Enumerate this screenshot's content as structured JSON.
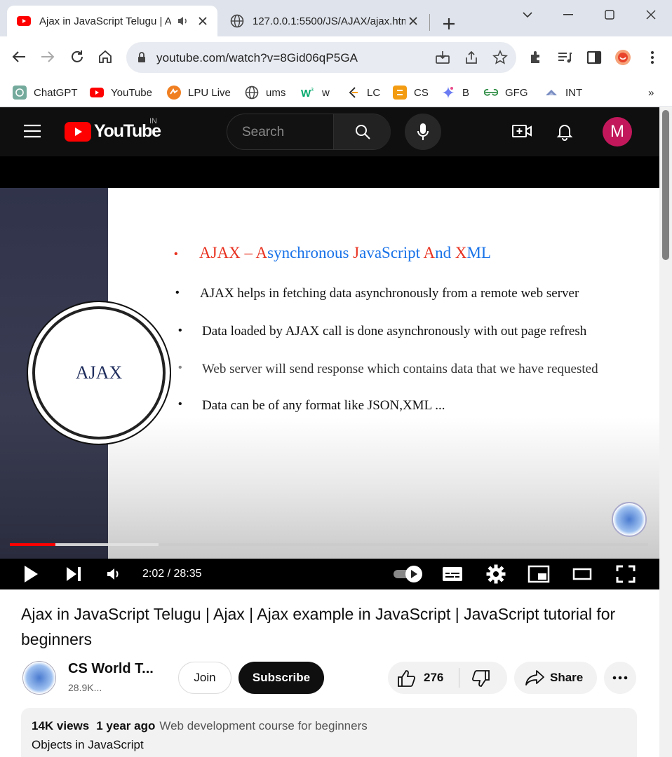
{
  "browser": {
    "tabs": [
      {
        "title": "Ajax in JavaScript Telugu | A",
        "active": true,
        "favicon": "youtube-icon",
        "audio": true
      },
      {
        "title": "127.0.0.1:5500/JS/AJAX/ajax.htm",
        "active": false,
        "favicon": "globe-icon"
      }
    ],
    "url": "youtube.com/watch?v=8Gid06qP5GA",
    "bookmarks": [
      {
        "label": "ChatGPT",
        "icon": "chatgpt-icon"
      },
      {
        "label": "YouTube",
        "icon": "youtube-icon"
      },
      {
        "label": "LPU Live",
        "icon": "lpu-icon"
      },
      {
        "label": "ums",
        "icon": "globe-icon"
      },
      {
        "label": "w",
        "icon": "w3schools-icon"
      },
      {
        "label": "LC",
        "icon": "leetcode-icon"
      },
      {
        "label": "CS",
        "icon": "codestudio-icon"
      },
      {
        "label": "B",
        "icon": "gemini-icon"
      },
      {
        "label": "GFG",
        "icon": "gfg-icon"
      },
      {
        "label": "INT",
        "icon": "int-icon"
      }
    ],
    "more_bookmarks": "»"
  },
  "youtube": {
    "logo_text": "YouTube",
    "region": "IN",
    "search_placeholder": "Search",
    "avatar_letter": "M",
    "accent": "#ff0000"
  },
  "slide": {
    "circle_label": "AJAX",
    "heading": {
      "a": "AJAX – ",
      "b": "A",
      "c": "synchronous ",
      "d": "J",
      "e": "avaScript ",
      "f": "A",
      "g": "nd ",
      "h": "X",
      "i": "ML"
    },
    "points": [
      "AJAX helps in fetching data asynchronously from a remote web server",
      "Data loaded by AJAX call is done asynchronously with out page refresh",
      "Web server will send response which contains data that we  have requested",
      "Data can be of any format like JSON,XML ..."
    ]
  },
  "player": {
    "time": "2:02 / 28:35",
    "progress_fraction": 0.0712,
    "buffered_fraction": 0.233
  },
  "video": {
    "title": "Ajax in JavaScript Telugu | Ajax | Ajax example in JavaScript | JavaScript tutorial for beginners",
    "channel": "CS World T...",
    "subscribers": "28.9K...",
    "join_label": "Join",
    "subscribe_label": "Subscribe",
    "likes": "276",
    "share_label": "Share",
    "views": "14K views",
    "age": "1 year ago",
    "tag": "Web development course for beginners",
    "description": "Objects in JavaScript"
  }
}
